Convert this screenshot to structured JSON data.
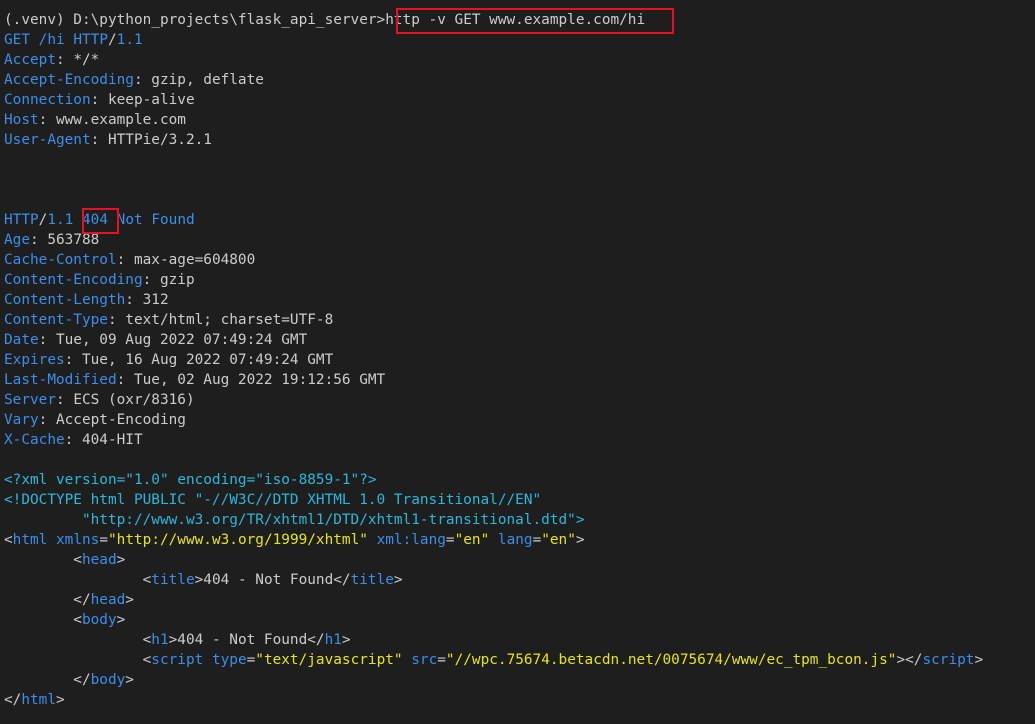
{
  "colors": {
    "background": "#1e1e1e",
    "text": "#cccccc",
    "keyword": "#3b8eea",
    "string": "#e5e510",
    "declaration": "#29b8db",
    "highlight": "#e81123"
  },
  "prompt": {
    "env": "(.venv) D:\\python_projects\\flask_api_server>",
    "command": "http -v GET www.example.com/hi"
  },
  "request": {
    "method": "GET",
    "path": "/hi",
    "proto": "HTTP",
    "version": "1.1",
    "headers": [
      {
        "name": "Accept",
        "value": "*/*"
      },
      {
        "name": "Accept-Encoding",
        "value": "gzip, deflate"
      },
      {
        "name": "Connection",
        "value": "keep-alive"
      },
      {
        "name": "Host",
        "value": "www.example.com"
      },
      {
        "name": "User-Agent",
        "value": "HTTPie/3.2.1"
      }
    ]
  },
  "response": {
    "proto": "HTTP",
    "version": "1.1",
    "status_code": "404",
    "status_text": "Not Found",
    "headers": [
      {
        "name": "Age",
        "value": "563788"
      },
      {
        "name": "Cache-Control",
        "value": "max-age=604800"
      },
      {
        "name": "Content-Encoding",
        "value": "gzip"
      },
      {
        "name": "Content-Length",
        "value": "312"
      },
      {
        "name": "Content-Type",
        "value": "text/html; charset=UTF-8"
      },
      {
        "name": "Date",
        "value": "Tue, 09 Aug 2022 07:49:24 GMT"
      },
      {
        "name": "Expires",
        "value": "Tue, 16 Aug 2022 07:49:24 GMT"
      },
      {
        "name": "Last-Modified",
        "value": "Tue, 02 Aug 2022 19:12:56 GMT"
      },
      {
        "name": "Server",
        "value": "ECS (oxr/8316)"
      },
      {
        "name": "Vary",
        "value": "Accept-Encoding"
      },
      {
        "name": "X-Cache",
        "value": "404-HIT"
      }
    ]
  },
  "body": {
    "xml_decl": "<?xml version=\"1.0\" encoding=\"iso-8859-1\"?>",
    "doctype_1": "<!DOCTYPE html PUBLIC \"-//W3C//DTD XHTML 1.0 Transitional//EN\"",
    "doctype_2": "         \"http://www.w3.org/TR/xhtml1/DTD/xhtml1-transitional.dtd\">",
    "html_open": {
      "tag": "html",
      "attr1_name": "xmlns",
      "attr1_value": "\"http://www.w3.org/1999/xhtml\"",
      "attr2_name": "xml:lang",
      "attr2_value": "\"en\"",
      "attr3_name": "lang",
      "attr3_value": "\"en\""
    },
    "head_tag": "head",
    "title_tag": "title",
    "title_text": "404 - Not Found",
    "body_tag": "body",
    "h1_tag": "h1",
    "h1_text": "404 - Not Found",
    "script": {
      "tag": "script",
      "attr1_name": "type",
      "attr1_value": "\"text/javascript\"",
      "attr2_name": "src",
      "attr2_value": "\"//wpc.75674.betacdn.net/0075674/www/ec_tpm_bcon.js\""
    }
  }
}
